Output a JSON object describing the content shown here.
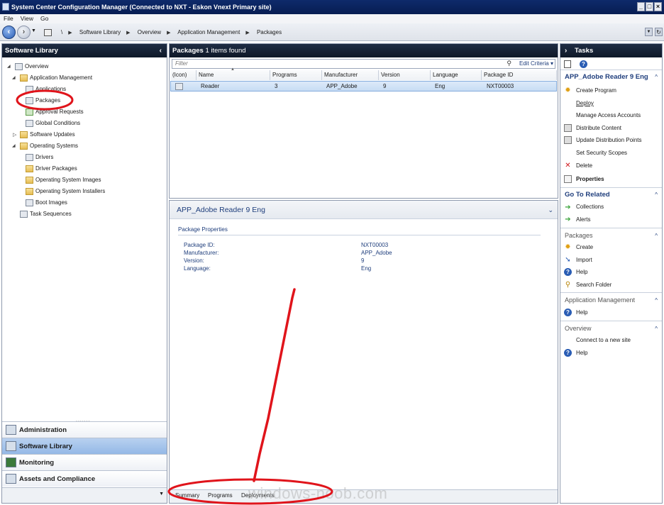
{
  "window": {
    "title": "System Center Configuration Manager (Connected to NXT - Eskon Vnext Primary site)"
  },
  "menu": {
    "items": [
      "File",
      "View",
      "Go"
    ]
  },
  "breadcrumb": {
    "items": [
      "\\",
      "Software Library",
      "Overview",
      "Application Management",
      "Packages"
    ]
  },
  "left": {
    "title": "Software Library",
    "tree": [
      "Overview",
      "Application Management",
      "Applications",
      "Packages",
      "Approval Requests",
      "Global Conditions",
      "Software Updates",
      "Operating Systems",
      "Drivers",
      "Driver Packages",
      "Operating System Images",
      "Operating System Installers",
      "Boot Images",
      "Task Sequences"
    ],
    "workspaces": [
      "Administration",
      "Software Library",
      "Monitoring",
      "Assets and Compliance"
    ]
  },
  "list": {
    "title": "Packages",
    "count": "1 items found",
    "filter_placeholder": "Filter",
    "edit_criteria": "Edit Criteria",
    "columns": [
      "(Icon)",
      "Name",
      "Programs",
      "Manufacturer",
      "Version",
      "Language",
      "Package ID"
    ],
    "rows": [
      {
        "name": "Reader",
        "programs": "3",
        "manufacturer": "APP_Adobe",
        "version": "9",
        "language": "Eng",
        "package_id": "NXT00003"
      }
    ]
  },
  "details": {
    "title": "APP_Adobe Reader 9 Eng",
    "section": "Package Properties",
    "labels": [
      "Package ID:",
      "Manufacturer:",
      "Version:",
      "Language:"
    ],
    "values": [
      "NXT00003",
      "APP_Adobe",
      "9",
      "Eng"
    ],
    "tabs": [
      "Summary",
      "Programs",
      "Deployments"
    ]
  },
  "tasks": {
    "title": "Tasks",
    "context_title": "APP_Adobe Reader 9 Eng",
    "actions": [
      "Create Program",
      "Deploy",
      "Manage Access Accounts",
      "Distribute Content",
      "Update Distribution Points",
      "Set Security Scopes",
      "Delete",
      "Properties"
    ],
    "goto_title": "Go To Related",
    "goto": [
      "Collections",
      "Alerts"
    ],
    "packages_title": "Packages",
    "packages": [
      "Create",
      "Import",
      "Help",
      "Search Folder"
    ],
    "appmgmt_title": "Application Management",
    "appmgmt": [
      "Help"
    ],
    "overview_title": "Overview",
    "overview": [
      "Connect to a new site",
      "Help"
    ]
  },
  "watermark": "windows-noob.com",
  "colors": {
    "accent": "#1f3e7c",
    "header": "#1f2d44",
    "annotation": "#e0141b",
    "selection": "#c7dcf4"
  }
}
